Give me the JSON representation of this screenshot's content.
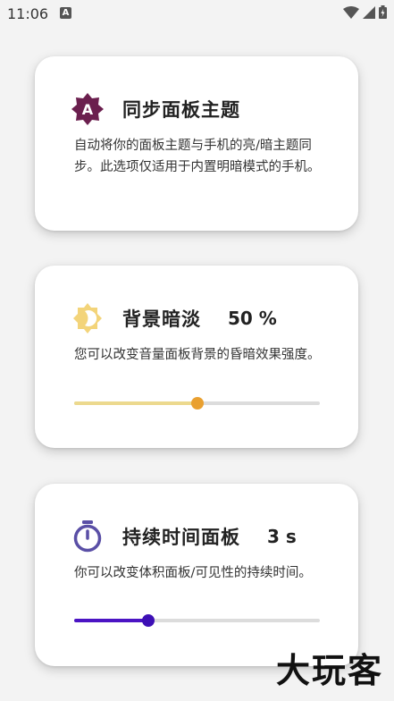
{
  "status_bar": {
    "time": "11:06",
    "notification_letter": "A",
    "icons": [
      "wifi-icon",
      "signal-icon",
      "battery-icon"
    ]
  },
  "cards": [
    {
      "icon": "auto-theme-icon",
      "icon_letter": "A",
      "title": "同步面板主题",
      "description": "自动将你的面板主题与手机的亮/暗主题同步。此选项仅适用于内置明暗模式的手机。"
    },
    {
      "icon": "dim-brightness-icon",
      "title": "背景暗淡",
      "value": "50 %",
      "description": "您可以改变音量面板背景的昏暗效果强度。",
      "slider_level": 0.5,
      "colors": {
        "fill": "#ecd98e",
        "thumb": "#e9a030"
      }
    },
    {
      "icon": "timer-icon",
      "title": "持续时间面板",
      "value": "3 s",
      "description": "你可以改变体积面板/可见性的持续时间。",
      "slider_level": 0.3,
      "colors": {
        "fill": "#4b14c4",
        "thumb": "#3d0fb5"
      }
    }
  ],
  "watermark": "大玩客",
  "colors": {
    "auto_theme_icon": "#6b1f4e",
    "timer_icon": "#5a4fa6",
    "sun_icon": "#f3d47a"
  }
}
